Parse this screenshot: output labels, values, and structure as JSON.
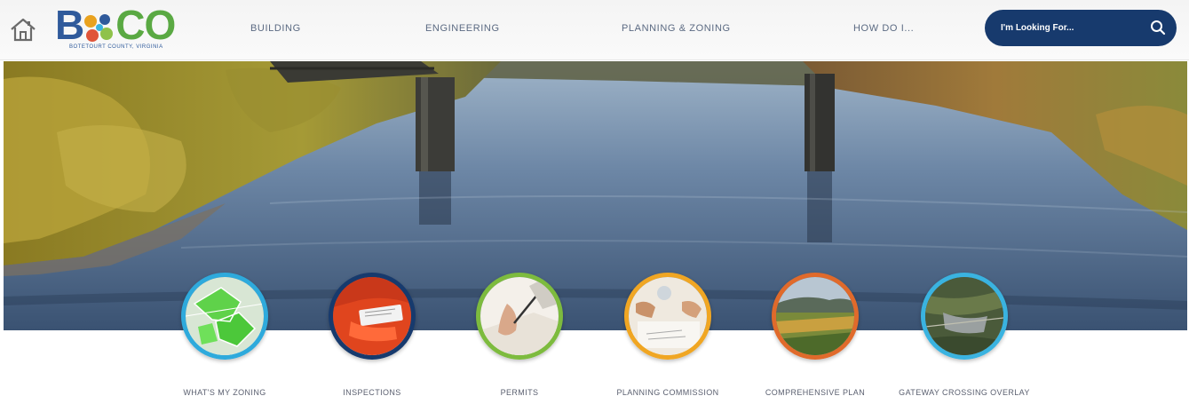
{
  "header": {
    "logo_text_b": "B",
    "logo_text_co": "CO",
    "logo_subtitle": "BOTETOURT COUNTY, VIRGINIA",
    "nav": [
      {
        "label": "BUILDING"
      },
      {
        "label": "ENGINEERING"
      },
      {
        "label": "PLANNING & ZONING"
      },
      {
        "label": "HOW DO I..."
      }
    ],
    "search": {
      "placeholder": "I'm Looking For..."
    },
    "icons": {
      "home": "home-icon",
      "search": "search-icon"
    }
  },
  "quick_links": [
    {
      "label": "WHAT'S MY ZONING",
      "ring_color": "#2eaadc"
    },
    {
      "label": "INSPECTIONS",
      "ring_color": "#173a6d"
    },
    {
      "label": "PERMITS",
      "ring_color": "#7dbb3e"
    },
    {
      "label": "PLANNING COMMISSION",
      "ring_color": "#f0a623"
    },
    {
      "label": "COMPREHENSIVE PLAN",
      "ring_color": "#e06a2b"
    },
    {
      "label": "GATEWAY CROSSING OVERLAY",
      "ring_color": "#3ab3e0"
    }
  ]
}
